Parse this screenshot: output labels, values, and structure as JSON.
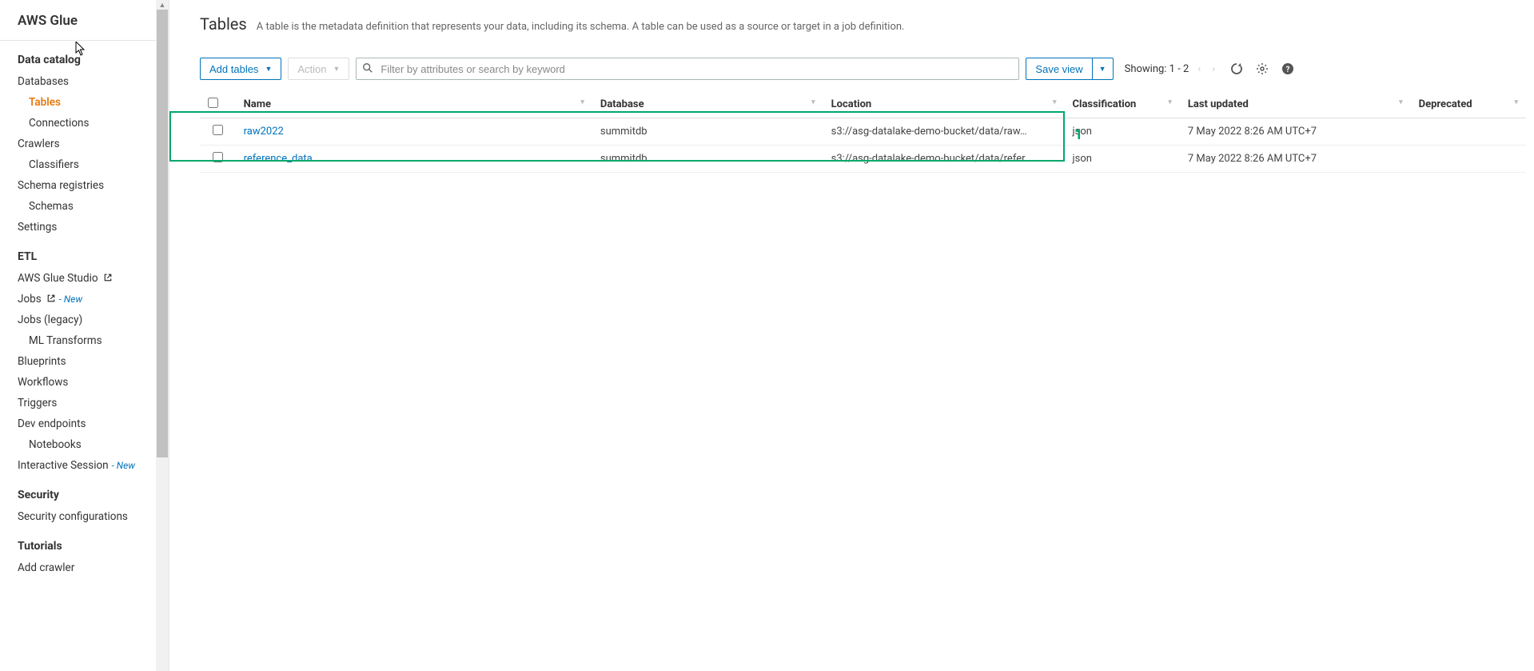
{
  "sidebar": {
    "brand": "AWS Glue",
    "sections": [
      {
        "title": "Data catalog",
        "items": [
          {
            "label": "Databases",
            "nested": false
          },
          {
            "label": "Tables",
            "nested": true,
            "active": true
          },
          {
            "label": "Connections",
            "nested": true
          },
          {
            "label": "Crawlers",
            "nested": false
          },
          {
            "label": "Classifiers",
            "nested": true
          },
          {
            "label": "Schema registries",
            "nested": false
          },
          {
            "label": "Schemas",
            "nested": true
          },
          {
            "label": "Settings",
            "nested": false
          }
        ]
      },
      {
        "title": "ETL",
        "items": [
          {
            "label": "AWS Glue Studio",
            "external": true
          },
          {
            "label": "Jobs",
            "external": true,
            "new": true
          },
          {
            "label": "Jobs (legacy)"
          },
          {
            "label": "ML Transforms",
            "nested": true
          },
          {
            "label": "Blueprints"
          },
          {
            "label": "Workflows"
          },
          {
            "label": "Triggers"
          },
          {
            "label": "Dev endpoints"
          },
          {
            "label": "Notebooks",
            "nested": true
          },
          {
            "label": "Interactive Session",
            "new": true
          }
        ]
      },
      {
        "title": "Security",
        "items": [
          {
            "label": "Security configurations"
          }
        ]
      },
      {
        "title": "Tutorials",
        "items": [
          {
            "label": "Add crawler"
          }
        ]
      }
    ],
    "new_label": "- New"
  },
  "page": {
    "title": "Tables",
    "description": "A table is the metadata definition that represents your data, including its schema. A table can be used as a source or target in a job definition."
  },
  "toolbar": {
    "add_tables": "Add tables",
    "action": "Action",
    "filter_placeholder": "Filter by attributes or search by keyword",
    "save_view": "Save view",
    "showing": "Showing: 1 - 2"
  },
  "table": {
    "headers": {
      "name": "Name",
      "database": "Database",
      "location": "Location",
      "classification": "Classification",
      "last_updated": "Last updated",
      "deprecated": "Deprecated"
    },
    "rows": [
      {
        "name": "raw2022",
        "database": "summitdb",
        "location": "s3://asg-datalake-demo-bucket/data/raw…",
        "classification": "json",
        "last_updated": "7 May 2022 8:26 AM UTC+7",
        "deprecated": ""
      },
      {
        "name": "reference_data",
        "database": "summitdb",
        "location": "s3://asg-datalake-demo-bucket/data/refer…",
        "classification": "json",
        "last_updated": "7 May 2022 8:26 AM UTC+7",
        "deprecated": ""
      }
    ]
  },
  "annotation": {
    "label": "1"
  }
}
